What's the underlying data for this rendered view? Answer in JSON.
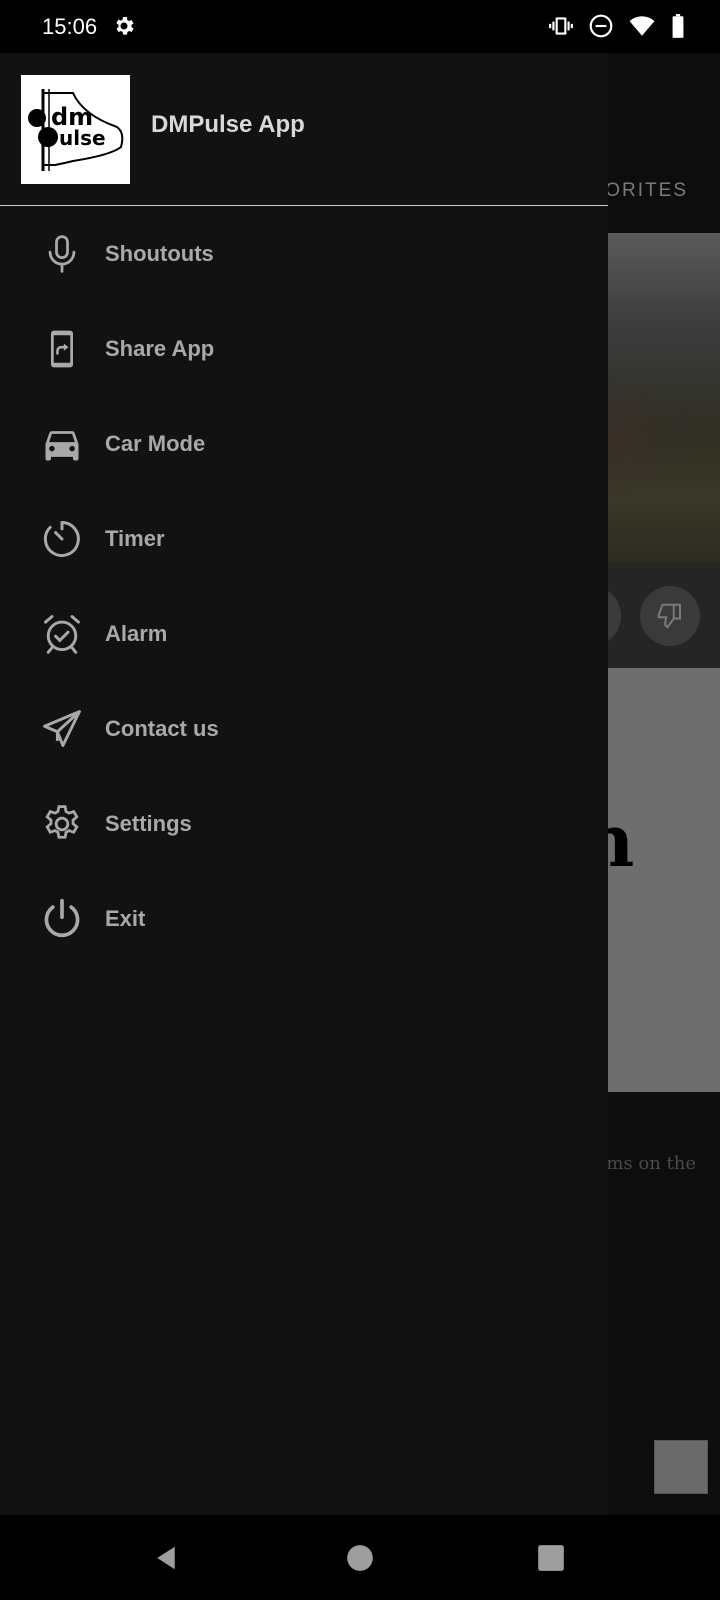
{
  "status_bar": {
    "time": "15:06",
    "icons": [
      "gear-icon",
      "vibrate-icon",
      "dnd-icon",
      "wifi-icon",
      "battery-icon"
    ]
  },
  "background": {
    "tab_partial": "VORITES",
    "text_partial": "ums on the",
    "card_glyph": "n"
  },
  "drawer": {
    "app_name": "DMPulse App",
    "logo_text": {
      "top": "dm",
      "bottom": "pulse"
    },
    "items": [
      {
        "label": "Shoutouts",
        "icon": "microphone-icon"
      },
      {
        "label": "Share App",
        "icon": "share-app-icon"
      },
      {
        "label": "Car Mode",
        "icon": "car-icon"
      },
      {
        "label": "Timer",
        "icon": "timer-icon"
      },
      {
        "label": "Alarm",
        "icon": "alarm-icon"
      },
      {
        "label": "Contact us",
        "icon": "send-icon"
      },
      {
        "label": "Settings",
        "icon": "gear-icon"
      },
      {
        "label": "Exit",
        "icon": "power-icon"
      }
    ]
  },
  "nav_bar": {
    "buttons": [
      "back-button",
      "home-button",
      "recents-button"
    ]
  },
  "colors": {
    "drawer_bg": "#121212",
    "label": "#a9a9a9",
    "title": "#d9d9d9",
    "divider": "#cfcfcf"
  }
}
